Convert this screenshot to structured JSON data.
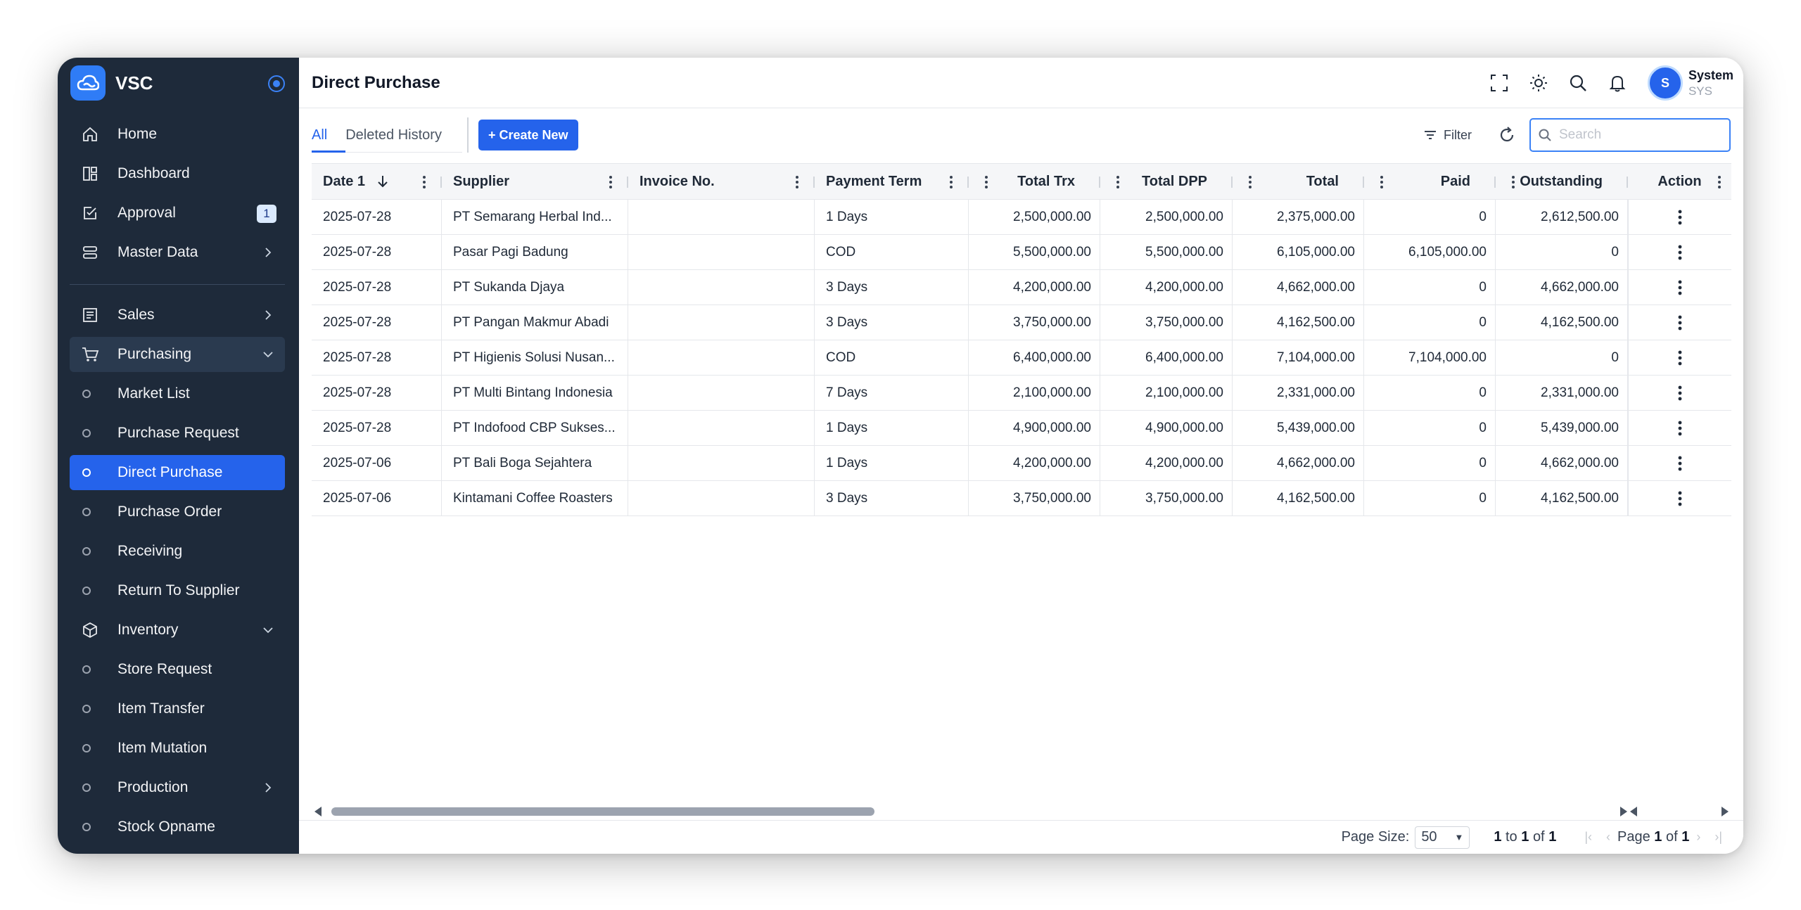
{
  "app": {
    "name": "VSC"
  },
  "sidebar": {
    "items": [
      {
        "label": "Home",
        "icon": "home-icon"
      },
      {
        "label": "Dashboard",
        "icon": "dashboard-icon"
      },
      {
        "label": "Approval",
        "icon": "approval-icon",
        "badge": "1"
      },
      {
        "label": "Master Data",
        "icon": "database-icon"
      }
    ],
    "sections": [
      {
        "label": "Sales",
        "icon": "sales-icon"
      },
      {
        "label": "Purchasing",
        "icon": "cart-icon"
      },
      {
        "label": "Market List"
      },
      {
        "label": "Purchase Request"
      },
      {
        "label": "Direct Purchase"
      },
      {
        "label": "Purchase Order"
      },
      {
        "label": "Receiving"
      },
      {
        "label": "Return To Supplier"
      },
      {
        "label": "Inventory",
        "icon": "box-icon"
      },
      {
        "label": "Store Request"
      },
      {
        "label": "Item Transfer"
      },
      {
        "label": "Item Mutation"
      },
      {
        "label": "Production"
      },
      {
        "label": "Stock Opname"
      }
    ]
  },
  "header": {
    "title": "Direct Purchase"
  },
  "user": {
    "initial": "S",
    "name": "System",
    "code": "SYS"
  },
  "tabs": [
    {
      "label": "All"
    },
    {
      "label": "Deleted History"
    }
  ],
  "toolbar": {
    "create_label": "+ Create New",
    "filter_label": "Filter",
    "search_placeholder": "Search"
  },
  "table": {
    "headers": {
      "date": "Date 1",
      "supplier": "Supplier",
      "invoice": "Invoice No.",
      "term": "Payment Term",
      "trx": "Total Trx",
      "dpp": "Total DPP",
      "total": "Total",
      "paid": "Paid",
      "outstanding": "Outstanding",
      "action": "Action"
    },
    "rows": [
      {
        "date": "2025-07-28",
        "supplier": "PT Semarang Herbal Ind...",
        "invoice": "",
        "term": "1 Days",
        "trx": "2,500,000.00",
        "dpp": "2,500,000.00",
        "total": "2,375,000.00",
        "paid": "0",
        "outstanding": "2,612,500.00"
      },
      {
        "date": "2025-07-28",
        "supplier": "Pasar Pagi Badung",
        "invoice": "",
        "term": "COD",
        "trx": "5,500,000.00",
        "dpp": "5,500,000.00",
        "total": "6,105,000.00",
        "paid": "6,105,000.00",
        "outstanding": "0"
      },
      {
        "date": "2025-07-28",
        "supplier": "PT Sukanda Djaya",
        "invoice": "",
        "term": "3 Days",
        "trx": "4,200,000.00",
        "dpp": "4,200,000.00",
        "total": "4,662,000.00",
        "paid": "0",
        "outstanding": "4,662,000.00"
      },
      {
        "date": "2025-07-28",
        "supplier": "PT Pangan Makmur Abadi",
        "invoice": "",
        "term": "3 Days",
        "trx": "3,750,000.00",
        "dpp": "3,750,000.00",
        "total": "4,162,500.00",
        "paid": "0",
        "outstanding": "4,162,500.00"
      },
      {
        "date": "2025-07-28",
        "supplier": "PT Higienis Solusi Nusan...",
        "invoice": "",
        "term": "COD",
        "trx": "6,400,000.00",
        "dpp": "6,400,000.00",
        "total": "7,104,000.00",
        "paid": "7,104,000.00",
        "outstanding": "0"
      },
      {
        "date": "2025-07-28",
        "supplier": "PT Multi Bintang Indonesia",
        "invoice": "",
        "term": "7 Days",
        "trx": "2,100,000.00",
        "dpp": "2,100,000.00",
        "total": "2,331,000.00",
        "paid": "0",
        "outstanding": "2,331,000.00"
      },
      {
        "date": "2025-07-28",
        "supplier": "PT Indofood CBP Sukses...",
        "invoice": "",
        "term": "1 Days",
        "trx": "4,900,000.00",
        "dpp": "4,900,000.00",
        "total": "5,439,000.00",
        "paid": "0",
        "outstanding": "5,439,000.00"
      },
      {
        "date": "2025-07-06",
        "supplier": "PT Bali Boga Sejahtera",
        "invoice": "",
        "term": "1 Days",
        "trx": "4,200,000.00",
        "dpp": "4,200,000.00",
        "total": "4,662,000.00",
        "paid": "0",
        "outstanding": "4,662,000.00"
      },
      {
        "date": "2025-07-06",
        "supplier": "Kintamani Coffee Roasters",
        "invoice": "",
        "term": "3 Days",
        "trx": "3,750,000.00",
        "dpp": "3,750,000.00",
        "total": "4,162,500.00",
        "paid": "0",
        "outstanding": "4,162,500.00"
      }
    ]
  },
  "footer": {
    "page_size_label": "Page Size:",
    "page_size": "50",
    "range_from": "1",
    "range_to_label": "to",
    "range_to": "1",
    "range_of_label": "of",
    "range_total": "1",
    "page_label": "Page",
    "page_current": "1",
    "page_of_label": "of",
    "page_total": "1"
  },
  "colors": {
    "sidebar": "#1e2a3a",
    "accent": "#2563eb"
  }
}
